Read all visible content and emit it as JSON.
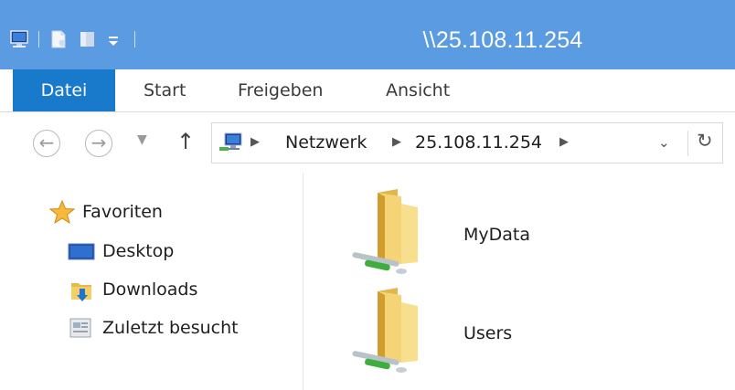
{
  "window": {
    "title": "\\\\25.108.11.254"
  },
  "ribbon": {
    "tabs": [
      {
        "label": "Datei"
      },
      {
        "label": "Start"
      },
      {
        "label": "Freigeben"
      },
      {
        "label": "Ansicht"
      }
    ]
  },
  "address": {
    "crumbs": [
      {
        "label": "Netzwerk"
      },
      {
        "label": "25.108.11.254"
      }
    ]
  },
  "navpane": {
    "favorites_label": "Favoriten",
    "items": [
      {
        "label": "Desktop",
        "icon": "desktop-icon"
      },
      {
        "label": "Downloads",
        "icon": "downloads-folder-icon"
      },
      {
        "label": "Zuletzt besucht",
        "icon": "recent-places-icon"
      }
    ]
  },
  "content": {
    "items": [
      {
        "label": "MyData",
        "icon": "network-share-folder-icon"
      },
      {
        "label": "Users",
        "icon": "network-share-folder-icon"
      }
    ]
  },
  "colors": {
    "titlebar": "#5a9be1",
    "file_tab": "#1979ca",
    "folder": "#f2cf6a",
    "network_pipe": "#3fae3f"
  }
}
